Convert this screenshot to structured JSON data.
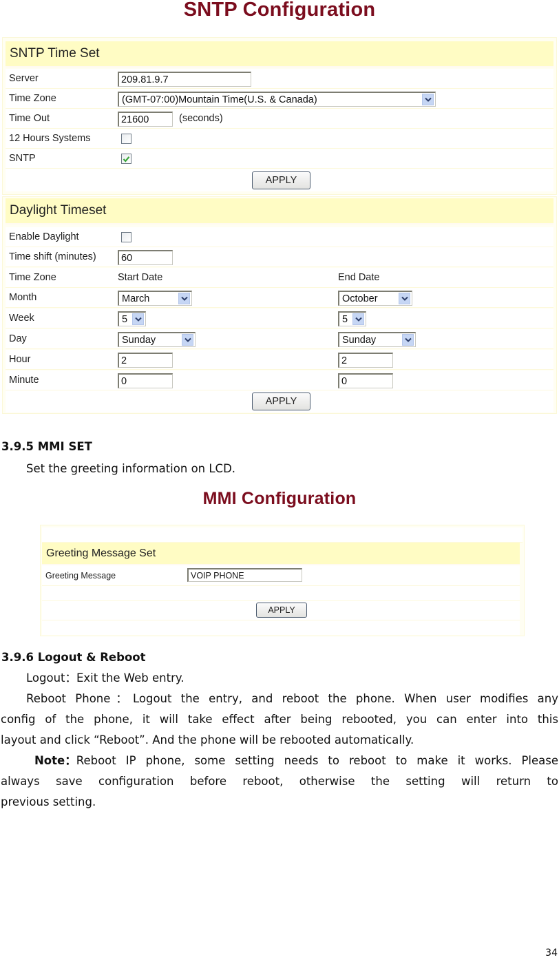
{
  "sntp": {
    "title": "SNTP Configuration",
    "time_set": {
      "heading": "SNTP Time Set",
      "server": {
        "label": "Server",
        "value": "209.81.9.7"
      },
      "time_zone": {
        "label": "Time Zone",
        "value": "(GMT-07:00)Mountain Time(U.S. & Canada)"
      },
      "time_out": {
        "label": "Time Out",
        "value": "21600",
        "unit": "(seconds)"
      },
      "hours12": {
        "label": "12 Hours Systems",
        "checked": false
      },
      "sntp": {
        "label": "SNTP",
        "checked": true
      },
      "apply_label": "APPLY"
    },
    "daylight": {
      "heading": "Daylight Timeset",
      "enable": {
        "label": "Enable Daylight",
        "checked": false
      },
      "time_shift": {
        "label": "Time shift (minutes)",
        "value": "60"
      },
      "columns": {
        "label": "Time Zone",
        "start": "Start Date",
        "end": "End Date"
      },
      "month": {
        "label": "Month",
        "start": "March",
        "end": "October"
      },
      "week": {
        "label": "Week",
        "start": "5",
        "end": "5"
      },
      "day": {
        "label": "Day",
        "start": "Sunday",
        "end": "Sunday"
      },
      "hour": {
        "label": "Hour",
        "start": "2",
        "end": "2"
      },
      "minute": {
        "label": "Minute",
        "start": "0",
        "end": "0"
      },
      "apply_label": "APPLY"
    }
  },
  "mmi_section": {
    "heading": "3.9.5 MMI SET",
    "description": "Set the greeting information on LCD."
  },
  "mmi": {
    "title": "MMI Configuration",
    "heading": "Greeting Message Set",
    "greeting": {
      "label": "Greeting Message",
      "value": "VOIP PHONE"
    },
    "apply_label": "APPLY"
  },
  "logout_section": {
    "heading": "3.9.6 Logout & Reboot",
    "logout_line": "Logout：Exit the Web entry.",
    "reboot_line1": "Reboot Phone：Logout the entry, and reboot the phone. When user modifies any",
    "reboot_line2": "config of the phone, it will take effect after being rebooted, you can enter into this",
    "reboot_line3": "layout and click “Reboot”. And the phone will be rebooted automatically.",
    "note_label": "Note：",
    "note_line1": "Reboot IP phone, some setting needs to reboot to make it works. Please",
    "note_line2": "always save configuration before reboot, otherwise the setting will return to",
    "note_line3": "previous setting."
  },
  "page_number": "34",
  "colors": {
    "title": "#7b0d1e",
    "section_head_bg": "#fffcc4",
    "panel_bg": "#fffef2",
    "checkbox_check": "#3aa53a",
    "dropdown_arrow_bg": "#c6d6f4"
  }
}
